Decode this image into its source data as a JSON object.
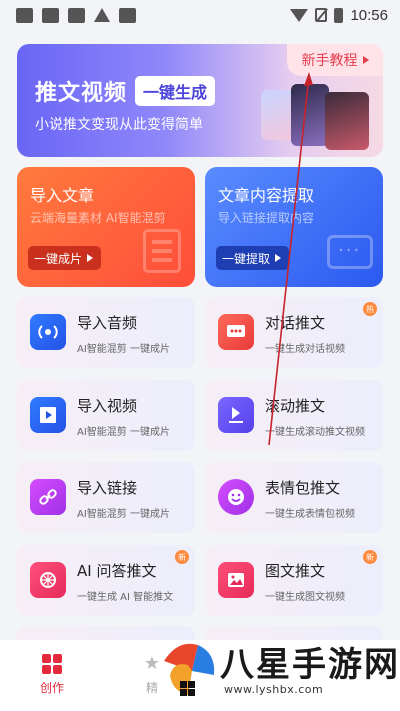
{
  "status_bar": {
    "time": "10:56"
  },
  "banner": {
    "title": "推文视频",
    "pill": "一键生成",
    "subtitle": "小说推文变现从此变得简单",
    "tutorial": "新手教程"
  },
  "cards": {
    "import_article": {
      "title": "导入文章",
      "subtitle": "云端海量素材 AI智能混剪",
      "button": "一键成片"
    },
    "extract_article": {
      "title": "文章内容提取",
      "subtitle": "导入链接提取内容",
      "button": "一键提取"
    }
  },
  "tiles": [
    {
      "title": "导入音频",
      "subtitle": "AI智能混剪 一键成片",
      "icon": "audio-icon",
      "badge": ""
    },
    {
      "title": "对话推文",
      "subtitle": "一键生成对话视频",
      "icon": "chat-icon",
      "badge": "热"
    },
    {
      "title": "导入视频",
      "subtitle": "AI智能混剪 一键成片",
      "icon": "film-icon",
      "badge": ""
    },
    {
      "title": "滚动推文",
      "subtitle": "一键生成滚动推文视频",
      "icon": "scroll-icon",
      "badge": ""
    },
    {
      "title": "导入链接",
      "subtitle": "AI智能混剪 一键成片",
      "icon": "link-icon",
      "badge": ""
    },
    {
      "title": "表情包推文",
      "subtitle": "一键生成表情包视频",
      "icon": "emoji-icon",
      "badge": ""
    },
    {
      "title": "AI 问答推文",
      "subtitle": "一键生成 AI 智能推文",
      "icon": "ai-icon",
      "badge": "新"
    },
    {
      "title": "图文推文",
      "subtitle": "一键生成图文视频",
      "icon": "image-icon",
      "badge": "新"
    }
  ],
  "bottom_nav": {
    "create": "创作",
    "fine": "精"
  },
  "watermark": {
    "text": "八星手游网",
    "url": "www.lyshbx.com"
  },
  "colors": {
    "accent": "#e32b3d",
    "banner_start": "#6a66f6",
    "card_orange": "#ff5a3a",
    "card_blue": "#3a6cf5"
  }
}
